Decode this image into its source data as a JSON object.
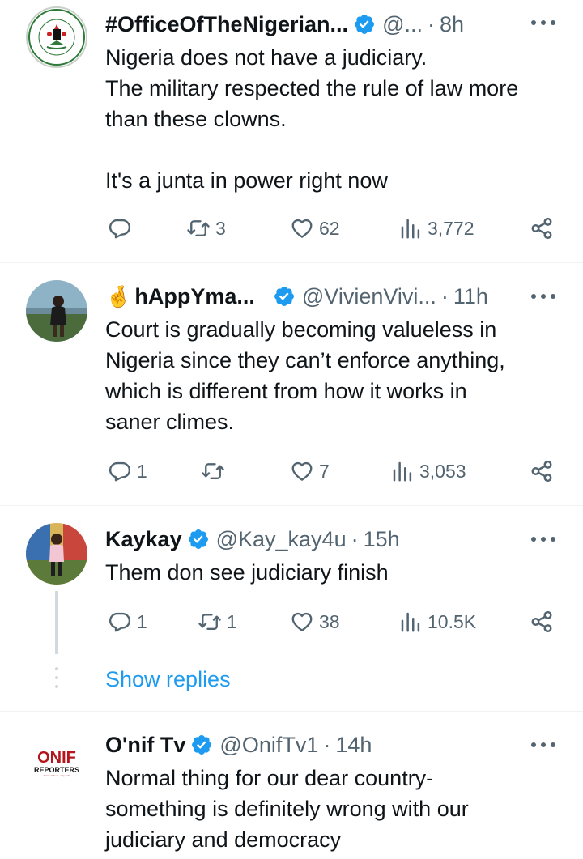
{
  "tweets": [
    {
      "name": "#OfficeOfTheNigerian...",
      "handle": "@...",
      "time": "8h",
      "body": [
        "Nigeria does not have a judiciary.",
        "The military respected the rule of law more",
        "than these clowns.",
        "",
        "It's a junta in power right now"
      ],
      "replies": "",
      "retweets": "3",
      "likes": "62",
      "views": "3,772",
      "avatar_text": [
        "OFFICE OF THE CITIZEN",
        "FEDERAL REPUBLIC OF NIGERIA"
      ]
    },
    {
      "name_emoji": "🤞",
      "name": "hAppYma...",
      "handle": "@VivienVivi...",
      "time": "11h",
      "body": [
        "Court is gradually becoming valueless in",
        "Nigeria since they can’t enforce anything,",
        "which is different from how it works in",
        "saner climes."
      ],
      "replies": "1",
      "retweets": "",
      "likes": "7",
      "views": "3,053"
    },
    {
      "name": "Kaykay",
      "handle": "@Kay_kay4u",
      "time": "15h",
      "body": [
        "Them don see judiciary finish"
      ],
      "replies": "1",
      "retweets": "1",
      "likes": "38",
      "views": "10.5K"
    },
    {
      "name": "O'nif Tv",
      "handle": "@OnifTv1",
      "time": "14h",
      "body": [
        "Normal thing for our dear country-",
        "something is definitely wrong with our",
        "judiciary and democracy"
      ],
      "avatar_text": [
        "ONIF",
        "REPORTERS",
        "Come with us...stay safe"
      ]
    }
  ],
  "show_replies_label": "Show replies",
  "colors": {
    "verified": "#1d9bf0",
    "text": "#0f1419",
    "muted": "#536471",
    "link": "#1d9bf0",
    "divider": "#eff3f4"
  }
}
